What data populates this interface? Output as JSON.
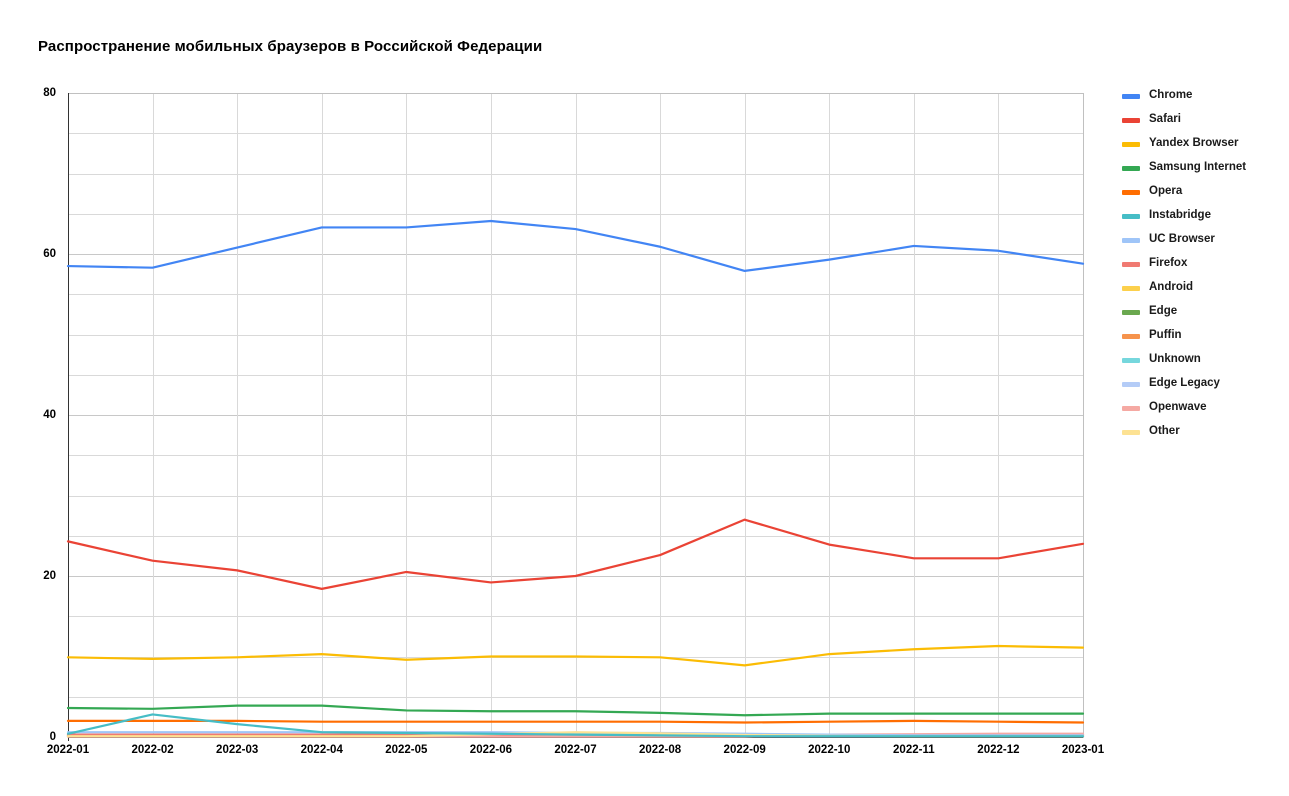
{
  "chart_data": {
    "type": "line",
    "title": "Распространение мобильных браузеров в Российской Федерации",
    "xlabel": "",
    "ylabel": "",
    "x": [
      "2022-01",
      "2022-02",
      "2022-03",
      "2022-04",
      "2022-05",
      "2022-06",
      "2022-07",
      "2022-08",
      "2022-09",
      "2022-10",
      "2022-11",
      "2022-12",
      "2023-01"
    ],
    "ylim": [
      0,
      80
    ],
    "yticks": [
      0,
      20,
      40,
      60,
      80
    ],
    "yticks_minor_step": 5,
    "grid": true,
    "legend_position": "right",
    "series": [
      {
        "name": "Chrome",
        "color": "#4285f4",
        "values": [
          58.5,
          58.3,
          60.8,
          63.3,
          63.3,
          64.1,
          63.1,
          60.9,
          57.9,
          59.3,
          61.0,
          60.4,
          58.8
        ]
      },
      {
        "name": "Safari",
        "color": "#ea4335",
        "values": [
          24.3,
          21.9,
          20.7,
          18.4,
          20.5,
          19.2,
          20.0,
          22.6,
          27.0,
          23.9,
          22.2,
          22.2,
          24.0
        ]
      },
      {
        "name": "Yandex Browser",
        "color": "#fbbc04",
        "values": [
          9.9,
          9.7,
          9.9,
          10.3,
          9.6,
          10.0,
          10.0,
          9.9,
          8.9,
          10.3,
          10.9,
          11.3,
          11.1
        ]
      },
      {
        "name": "Samsung Internet",
        "color": "#34a853",
        "values": [
          3.6,
          3.5,
          3.9,
          3.9,
          3.3,
          3.2,
          3.2,
          3.0,
          2.7,
          2.9,
          2.9,
          2.9,
          2.9
        ]
      },
      {
        "name": "Opera",
        "color": "#ff6d01",
        "values": [
          2.0,
          2.0,
          2.0,
          1.9,
          1.9,
          1.9,
          1.9,
          1.9,
          1.8,
          1.9,
          2.0,
          1.9,
          1.8
        ]
      },
      {
        "name": "Instabridge",
        "color": "#46bdc6",
        "values": [
          0.4,
          2.8,
          1.6,
          0.6,
          0.5,
          0.4,
          0.3,
          0.2,
          0.1,
          0.1,
          0.1,
          0.1,
          0.1
        ]
      },
      {
        "name": "UC Browser",
        "color": "#9fc5f8",
        "values": [
          0.6,
          0.6,
          0.6,
          0.6,
          0.6,
          0.6,
          0.5,
          0.5,
          0.4,
          0.3,
          0.2,
          0.2,
          0.2
        ]
      },
      {
        "name": "Firefox",
        "color": "#f07a72",
        "values": [
          0.3,
          0.3,
          0.3,
          0.3,
          0.3,
          0.3,
          0.3,
          0.3,
          0.3,
          0.3,
          0.3,
          0.3,
          0.3
        ]
      },
      {
        "name": "Android",
        "color": "#fcd04c",
        "values": [
          0.2,
          0.2,
          0.2,
          0.2,
          0.2,
          0.2,
          0.2,
          0.2,
          0.2,
          0.2,
          0.2,
          0.2,
          0.2
        ]
      },
      {
        "name": "Edge",
        "color": "#6aa84f",
        "values": [
          0.2,
          0.2,
          0.2,
          0.2,
          0.2,
          0.2,
          0.2,
          0.2,
          0.2,
          0.2,
          0.2,
          0.2,
          0.2
        ]
      },
      {
        "name": "Puffin",
        "color": "#f6934c",
        "values": [
          0.1,
          0.1,
          0.1,
          0.1,
          0.1,
          0.1,
          0.1,
          0.1,
          0.1,
          0.1,
          0.1,
          0.1,
          0.1
        ]
      },
      {
        "name": "Unknown",
        "color": "#76d7dd",
        "values": [
          0.1,
          0.1,
          0.1,
          0.1,
          0.1,
          0.1,
          0.1,
          0.1,
          0.1,
          0.1,
          0.1,
          0.1,
          0.1
        ]
      },
      {
        "name": "Edge Legacy",
        "color": "#b4ccf7",
        "values": [
          0.1,
          0.1,
          0.1,
          0.1,
          0.1,
          0.1,
          0.1,
          0.1,
          0.1,
          0.1,
          0.1,
          0.1,
          0.1
        ]
      },
      {
        "name": "Openwave",
        "color": "#f5a9a3",
        "values": [
          0.05,
          0.05,
          0.05,
          0.05,
          0.05,
          0.05,
          0.05,
          0.05,
          0.05,
          0.3,
          0.35,
          0.4,
          0.4
        ]
      },
      {
        "name": "Other",
        "color": "#fde293",
        "values": [
          0.1,
          0.1,
          0.1,
          0.1,
          0.1,
          0.35,
          0.6,
          0.45,
          0.25,
          0.15,
          0.1,
          0.1,
          0.1
        ]
      }
    ]
  },
  "legend": {
    "items": [
      {
        "label": "Chrome",
        "color": "#4285f4"
      },
      {
        "label": "Safari",
        "color": "#ea4335"
      },
      {
        "label": "Yandex Browser",
        "color": "#fbbc04"
      },
      {
        "label": "Samsung Internet",
        "color": "#34a853"
      },
      {
        "label": "Opera",
        "color": "#ff6d01"
      },
      {
        "label": "Instabridge",
        "color": "#46bdc6"
      },
      {
        "label": "UC Browser",
        "color": "#9fc5f8"
      },
      {
        "label": "Firefox",
        "color": "#f07a72"
      },
      {
        "label": "Android",
        "color": "#fcd04c"
      },
      {
        "label": "Edge",
        "color": "#6aa84f"
      },
      {
        "label": "Puffin",
        "color": "#f6934c"
      },
      {
        "label": "Unknown",
        "color": "#76d7dd"
      },
      {
        "label": "Edge Legacy",
        "color": "#b4ccf7"
      },
      {
        "label": "Openwave",
        "color": "#f5a9a3"
      },
      {
        "label": "Other",
        "color": "#fde293"
      }
    ]
  }
}
